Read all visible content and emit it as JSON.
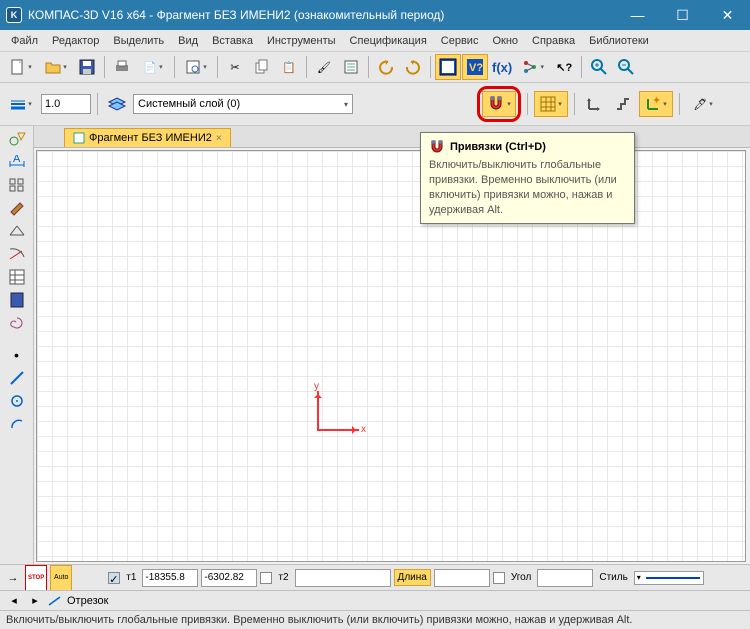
{
  "window": {
    "title": "КОМПАС-3D V16  x64 - Фрагмент БЕЗ ИМЕНИ2 (ознакомительный период)",
    "app_icon_letter": "K"
  },
  "menu": {
    "file": "Файл",
    "edit": "Редактор",
    "select": "Выделить",
    "view": "Вид",
    "insert": "Вставка",
    "tools": "Инструменты",
    "spec": "Спецификация",
    "service": "Сервис",
    "window": "Окно",
    "help": "Справка",
    "libs": "Библиотеки"
  },
  "layer": {
    "line_width": "1.0",
    "layer_label": "Системный слой (0)"
  },
  "doc_tab": {
    "label": "Фрагмент БЕЗ ИМЕНИ2",
    "close": "×"
  },
  "axes": {
    "x": "x",
    "y": "y"
  },
  "tooltip": {
    "title": "Привязки (Ctrl+D)",
    "body": "Включить/выключить глобальные привязки. Временно выключить (или включить) привязки можно, нажав и удерживая Alt."
  },
  "props": {
    "t1_label": "т1",
    "t1_x": "-18355.8",
    "t1_y": "-6302.82",
    "t2_label": "т2",
    "length_label": "Длина",
    "angle_label": "Угол",
    "style_label": "Стиль"
  },
  "entity": {
    "label": "Отрезок"
  },
  "statusbar": {
    "text": "Включить/выключить глобальные привязки. Временно выключить (или включить) привязки можно, нажав и удерживая Alt."
  },
  "icons": {
    "stop": "STOP",
    "auto": "Auto"
  }
}
